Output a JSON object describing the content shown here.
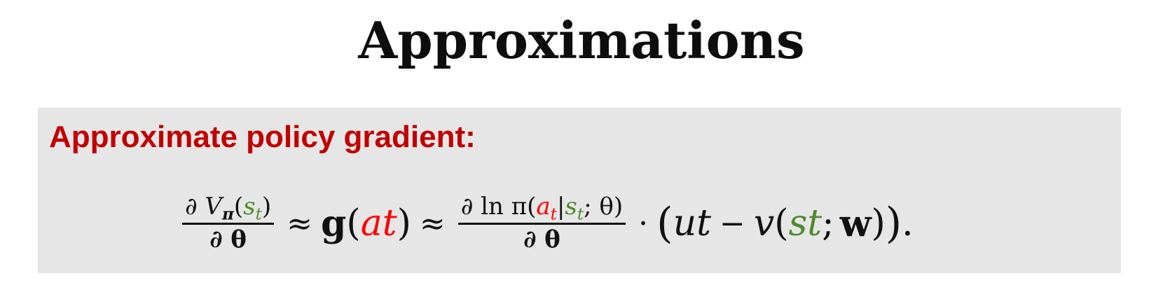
{
  "slide": {
    "title": "Approximations"
  },
  "box": {
    "heading": "Approximate policy gradient:",
    "background_color": "#e6e6e6",
    "heading_color": "#c00000",
    "highlight_colors": {
      "action": "#ff0000",
      "state": "#4f8a2c"
    }
  },
  "formula": {
    "lhs_num_partial": "∂",
    "lhs_num_V": "V",
    "lhs_num_pi_sub": "π",
    "lhs_num_open": "(",
    "lhs_num_s": "s",
    "lhs_num_t": "t",
    "lhs_num_close": ")",
    "lhs_den": "∂ θ",
    "approx1": "≈",
    "g": "g",
    "g_open": "(",
    "g_a": "a",
    "g_t": "t",
    "g_close": ")",
    "approx2": "≈",
    "rhs_num_prefix": "∂ ln π(",
    "rhs_num_a": "a",
    "rhs_num_a_sub": "t",
    "rhs_num_bar": "|",
    "rhs_num_s": "s",
    "rhs_num_s_sub": "t",
    "rhs_num_suffix": "; θ)",
    "rhs_den": "∂ θ",
    "dot": "·",
    "paren_open": "(",
    "u": "u",
    "u_sub": "t",
    "minus": "−",
    "v": "v",
    "v_open": "(",
    "v_s": "s",
    "v_s_sub": "t",
    "v_sep": ";",
    "v_w": "w",
    "v_close": ")",
    "paren_close": ")",
    "period": "."
  }
}
